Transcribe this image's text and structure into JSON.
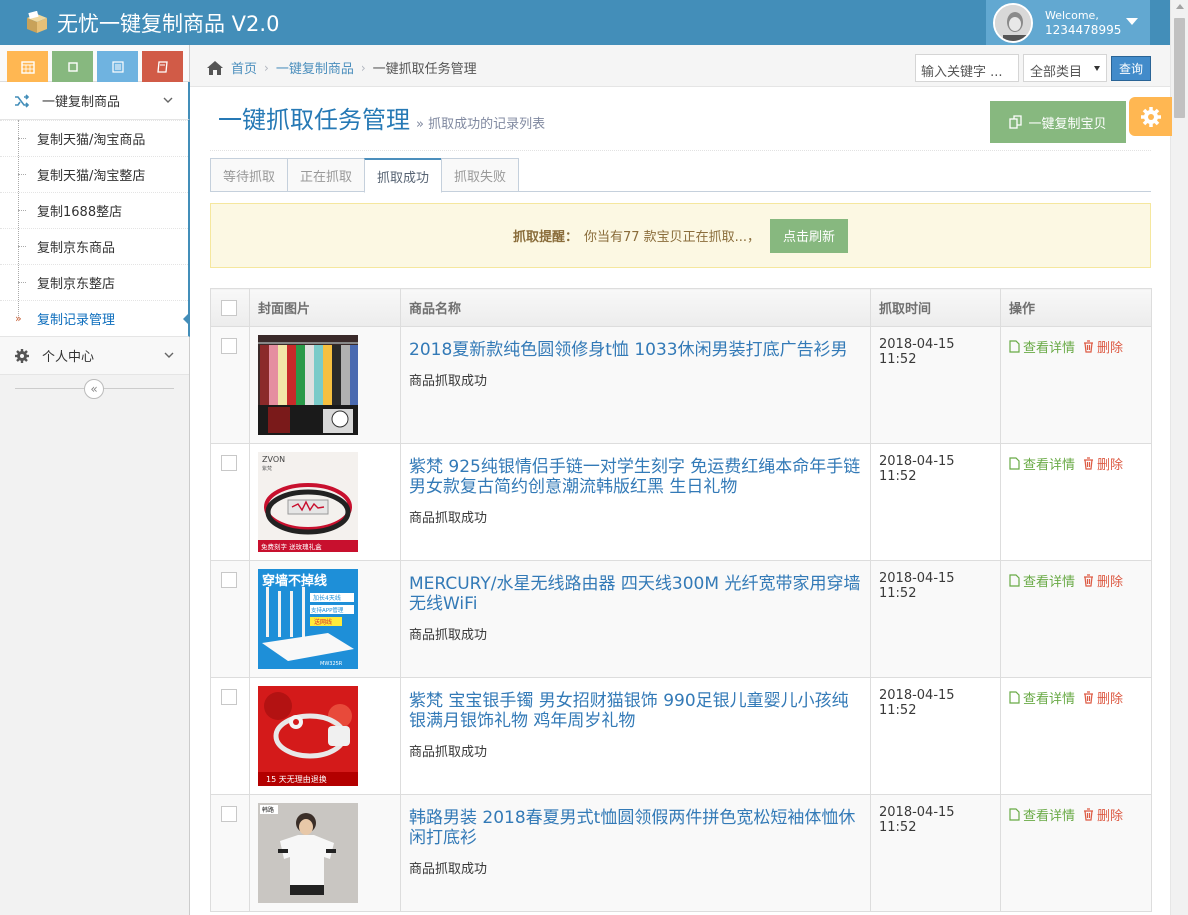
{
  "app": {
    "title": "无忧一键复制商品 V2.0"
  },
  "user": {
    "welcome": "Welcome,",
    "id": "1234478995"
  },
  "sidebar": {
    "menu_title": "一键复制商品",
    "items": [
      {
        "label": "复制天猫/淘宝商品"
      },
      {
        "label": "复制天猫/淘宝整店"
      },
      {
        "label": "复制1688整店"
      },
      {
        "label": "复制京东商品"
      },
      {
        "label": "复制京东整店"
      },
      {
        "label": "复制记录管理"
      }
    ],
    "personal": "个人中心",
    "collapse_glyph": "«"
  },
  "breadcrumb": {
    "home": "首页",
    "level1": "一键复制商品",
    "level2": "一键抓取任务管理"
  },
  "search": {
    "placeholder": "输入关键字 ...",
    "category": "全部类目",
    "button": "查询"
  },
  "header": {
    "title": "一键抓取任务管理",
    "subtitle": "» 抓取成功的记录列表",
    "copy_button": "一键复制宝贝"
  },
  "tabs": [
    {
      "label": "等待抓取"
    },
    {
      "label": "正在抓取"
    },
    {
      "label": "抓取成功"
    },
    {
      "label": "抓取失败"
    }
  ],
  "alert": {
    "label": "抓取提醒：",
    "text": "你当有77 款宝贝正在抓取...，",
    "button": "点击刷新"
  },
  "table": {
    "headers": [
      "封面图片",
      "商品名称",
      "抓取时间",
      "操作"
    ],
    "view_label": "查看详情",
    "delete_label": "删除",
    "rows": [
      {
        "title": "2018夏新款纯色圆领修身t恤 1033休闲男装打底广告衫男",
        "status": "商品抓取成功",
        "time": "2018-04-15 11:52"
      },
      {
        "title": "紫梵 925纯银情侣手链一对学生刻字 免运费红绳本命年手链男女款复古简约创意潮流韩版红黑 生日礼物",
        "status": "商品抓取成功",
        "time": "2018-04-15 11:52",
        "thumb_text": [
          "ZVON",
          "紫梵",
          "免费刻字 送玫瑰礼盒"
        ]
      },
      {
        "title": "MERCURY/水星无线路由器 四天线300M 光纤宽带家用穿墙无线WiFi",
        "status": "商品抓取成功",
        "time": "2018-04-15 11:52",
        "thumb_text": [
          "穿墙不掉线",
          "加长4天线",
          "支持APP管理",
          "送网线",
          "MW325R"
        ]
      },
      {
        "title": "紫梵 宝宝银手镯 男女招财猫银饰 990足银儿童婴儿小孩纯银满月银饰礼物 鸡年周岁礼物",
        "status": "商品抓取成功",
        "time": "2018-04-15 11:52",
        "thumb_text": [
          "15 天无理由退换"
        ]
      },
      {
        "title": "韩路男装 2018春夏男式t恤圆领假两件拼色宽松短袖体恤休闲打底衫",
        "status": "商品抓取成功",
        "time": "2018-04-15 11:52",
        "thumb_text": [
          "韩路"
        ]
      }
    ]
  },
  "colors": {
    "navbar": "#438eb9",
    "accent": "#87b87f",
    "link": "#337ab7",
    "warning": "#ffb752",
    "danger": "#dd5a43"
  }
}
